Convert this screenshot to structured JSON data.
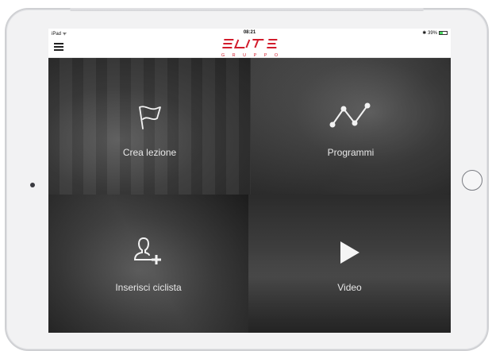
{
  "status_bar": {
    "left": "iPad ᯤ",
    "time": "08:21",
    "battery_text": "✱ 39%",
    "battery_level": 0.39
  },
  "header": {
    "logo_text": "ELITE",
    "logo_subtitle": "G R U P P O",
    "brand_color": "#d21c2c",
    "menu_icon": "hamburger-menu-icon"
  },
  "tiles": [
    {
      "label": "Crea lezione",
      "icon": "flag-icon"
    },
    {
      "label": "Programmi",
      "icon": "line-chart-icon"
    },
    {
      "label": "Inserisci ciclista",
      "icon": "add-user-icon"
    },
    {
      "label": "Video",
      "icon": "play-icon"
    }
  ]
}
